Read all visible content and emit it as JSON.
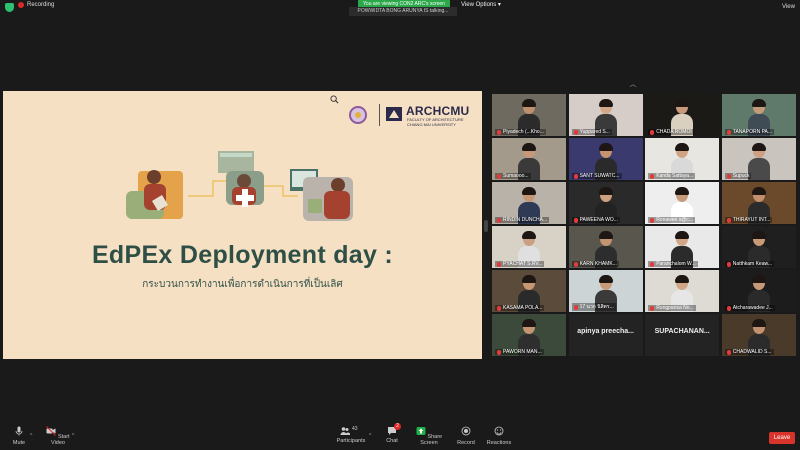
{
  "topbar": {
    "recording_label": "Recording",
    "viewing_banner": "You are viewing CON2 ARC's screen",
    "talking_banner": "POWWIDTA BONG ARUNYA IS talking...",
    "view_options_label": "View Options",
    "view_label": "View"
  },
  "slide": {
    "logo_name": "ARCHCMU",
    "logo_sub1": "FACULTY OF ARCHITECTURE",
    "logo_sub2": "CHIANG MAI UNIVERSITY",
    "title": "EdPEx Deployment day :",
    "subtitle": "กระบวนการทำงานเพื่อการดำเนินการที่เป็นเลิศ"
  },
  "gallery": {
    "tiles": [
      {
        "name": "Piyadech (...Kho...",
        "bg": "#6f6a60",
        "skin": "#c08f6d",
        "shirt": "#2b2b2b",
        "type": "person",
        "muted": true
      },
      {
        "name": "Yuppared S...",
        "bg": "#d6ccc8",
        "skin": "#d3a888",
        "shirt": "#3a3a3a",
        "type": "person",
        "muted": true
      },
      {
        "name": "CHADA ROMOI",
        "bg": "#1c1a17",
        "skin": "#c89a7b",
        "shirt": "#d9d0c0",
        "type": "person",
        "muted": true
      },
      {
        "name": "TANAPORN PA...",
        "bg": "#5f7a6a",
        "skin": "#c59a79",
        "shirt": "#3f4b55",
        "type": "person",
        "muted": true
      },
      {
        "name": "Sumaooo...",
        "bg": "#a39a8c",
        "skin": "#c89878",
        "shirt": "#3a3a3a",
        "type": "person",
        "muted": true
      },
      {
        "name": "SANT SUWATC...",
        "bg": "#3b3a6e",
        "skin": "#c59370",
        "shirt": "#2a2a2a",
        "type": "person",
        "muted": true
      },
      {
        "name": "Kanda Sattaya...",
        "bg": "#e8e6e1",
        "skin": "#d0a385",
        "shirt": "#d9d9d9",
        "type": "person",
        "muted": true
      },
      {
        "name": "Supuck",
        "bg": "#c9c4bd",
        "skin": "#cda081",
        "shirt": "#4a4a4a",
        "type": "person",
        "muted": true
      },
      {
        "name": "RINDIN DUNCHA...",
        "bg": "#b9b2a8",
        "skin": "#c69674",
        "shirt": "#2f3a55",
        "type": "person",
        "muted": true
      },
      {
        "name": "PAWEENA WO...",
        "bg": "#2a2a2a",
        "skin": "#cfa080",
        "shirt": "#222222",
        "type": "person",
        "muted": true
      },
      {
        "name": "Ronawee s@c...",
        "bg": "#eeeeee",
        "skin": "#c79a7b",
        "shirt": "#ffffff",
        "type": "person",
        "muted": true
      },
      {
        "name": "THIRAYUT INT...",
        "bg": "#6a4a2a",
        "skin": "#c2906d",
        "shirt": "#2b2b2b",
        "type": "person",
        "muted": true
      },
      {
        "name": "PYACHAT S.RV...",
        "bg": "#d8d2c6",
        "skin": "#caa083",
        "shirt": "#e0e0e0",
        "type": "person",
        "muted": true
      },
      {
        "name": "KARN KHAMK...",
        "bg": "#59564e",
        "skin": "#c4936f",
        "shirt": "#2d2d2d",
        "type": "person",
        "muted": true
      },
      {
        "name": "Paranchalom W...",
        "bg": "#e9e9e9",
        "skin": "#d1a686",
        "shirt": "#2b2b2b",
        "type": "person",
        "muted": true
      },
      {
        "name": "Natthkam Keaw...",
        "bg": "#1f1f1f",
        "skin": "#c99a78",
        "shirt": "#2b2b2b",
        "type": "person",
        "muted": true
      },
      {
        "name": "KASAMA POLA...",
        "bg": "#5a4b3a",
        "skin": "#c79773",
        "shirt": "#2a2a2a",
        "type": "person",
        "muted": true
      },
      {
        "name": "17 นวก นิสิตร...",
        "bg": "#cdd4d6",
        "skin": "#c89a78",
        "shirt": "#3a3a3a",
        "type": "person",
        "muted": true
      },
      {
        "name": "Rungpansa No...",
        "bg": "#dedbd5",
        "skin": "#d1a585",
        "shirt": "#e6e6e6",
        "type": "person",
        "muted": true
      },
      {
        "name": "Atcharawadee J...",
        "bg": "#1c1c1c",
        "skin": "#c69877",
        "shirt": "#2a2a2a",
        "type": "person",
        "muted": true
      },
      {
        "name": "PAWORN MAN...",
        "bg": "#3b4a3a",
        "skin": "#c49473",
        "shirt": "#2e2e2e",
        "type": "person",
        "muted": true
      },
      {
        "name": "apinya preecha...",
        "bg": "#232323",
        "type": "text",
        "muted": false
      },
      {
        "name": "SUPACHANAN...",
        "bg": "#232323",
        "type": "text",
        "muted": false
      },
      {
        "name": "CHADWALID S...",
        "bg": "#4a3a2a",
        "skin": "#c29270",
        "shirt": "#2b2b2b",
        "type": "person",
        "muted": true
      }
    ]
  },
  "toolbar": {
    "mute_label": "Mute",
    "start_video_label": "Start Video",
    "participants_label": "Participants",
    "participants_count": "43",
    "chat_label": "Chat",
    "chat_badge": "2",
    "share_screen_label": "Share Screen",
    "record_label": "Record",
    "reactions_label": "Reactions",
    "leave_label": "Leave"
  }
}
